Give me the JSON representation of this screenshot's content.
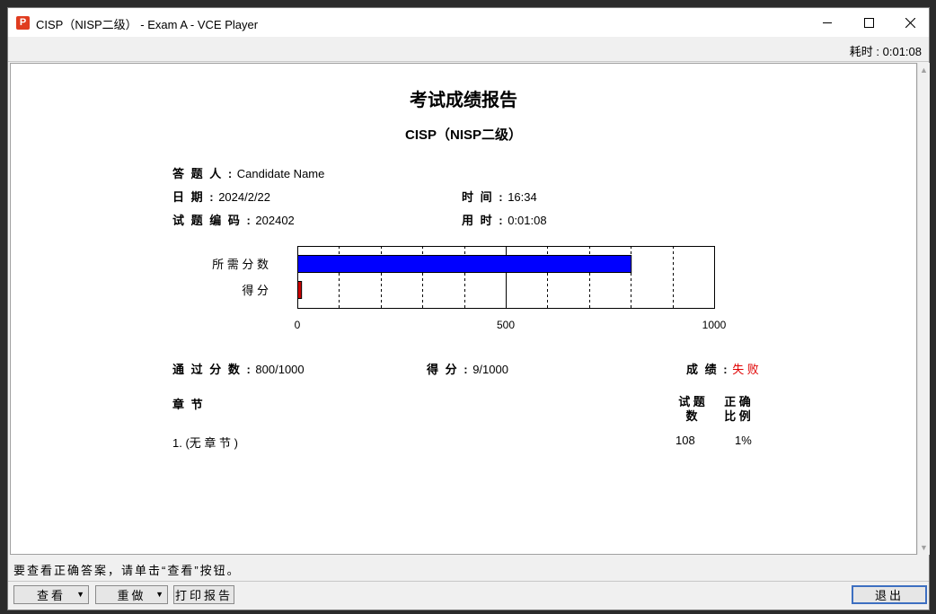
{
  "window": {
    "title": "CISP（NISP二级） - Exam A - VCE Player",
    "app_icon_letter": "P"
  },
  "timer": {
    "text": "耗时 : 0:01:08"
  },
  "report": {
    "title": "考试成绩报告",
    "subtitle": "CISP（NISP二级）",
    "candidate_label": "答 题 人 :",
    "candidate_value": "Candidate Name",
    "date_label": "日 期 :",
    "date_value": "2024/2/22",
    "time_label": "时 间 :",
    "time_value": "16:34",
    "code_label": "试 题 编 码 :",
    "code_value": "202402",
    "duration_label": "用 时 :",
    "duration_value": "0:01:08",
    "pass_label": "通 过 分 数 :",
    "pass_value": "800/1000",
    "score_label": "得 分 :",
    "score_value": "9/1000",
    "result_label": "成 绩 :",
    "result_value": "失 败",
    "section_header": "章 节",
    "count_header_1": "试 题",
    "count_header_2": "数",
    "ratio_header_1": "正 确",
    "ratio_header_2": "比 例",
    "row_section": "1. (无 章 节 )",
    "row_count": "108",
    "row_ratio": "1%"
  },
  "chart_data": {
    "type": "bar",
    "orientation": "horizontal",
    "categories": [
      "所 需 分 数",
      "得 分"
    ],
    "values": [
      800,
      9
    ],
    "colors": [
      "#0000ff",
      "#cc0000"
    ],
    "xlim": [
      0,
      1000
    ],
    "ticks": [
      0,
      500,
      1000
    ],
    "grid": true
  },
  "status": {
    "message": "要查看正确答案，请单击“查看”按钮。"
  },
  "buttons": {
    "review": "查看",
    "redo": "重做",
    "print": "打印报告",
    "exit": "退出"
  }
}
